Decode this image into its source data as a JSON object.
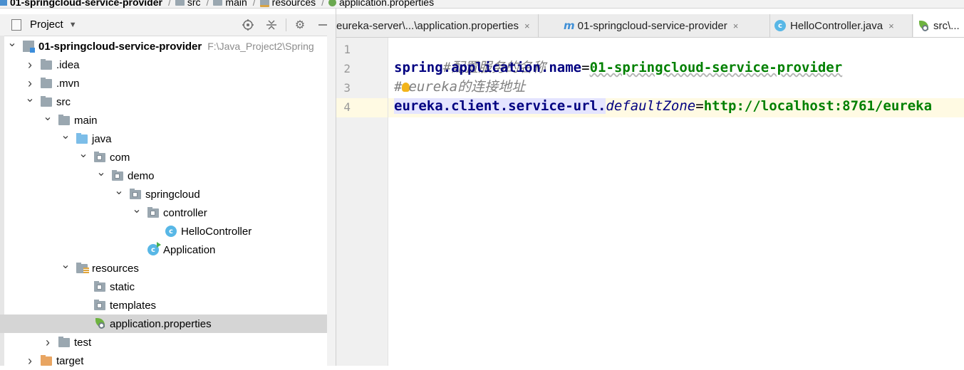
{
  "breadcrumb": {
    "project": "01-springcloud-service-provider",
    "items": [
      "src",
      "main",
      "resources",
      "application.properties"
    ]
  },
  "project_pane": {
    "title": "Project",
    "tree": [
      {
        "label": "01-springcloud-service-provider",
        "path": "F:\\Java_Project2\\Spring",
        "arrow": "down",
        "icon": "module-icon",
        "bold": true
      },
      {
        "label": ".idea",
        "arrow": "right",
        "icon": "folder-icon"
      },
      {
        "label": ".mvn",
        "arrow": "right",
        "icon": "folder-icon"
      },
      {
        "label": "src",
        "arrow": "down",
        "icon": "folder-icon"
      },
      {
        "label": "main",
        "arrow": "down",
        "icon": "folder-icon"
      },
      {
        "label": "java",
        "arrow": "down",
        "icon": "source-folder-icon"
      },
      {
        "label": "com",
        "arrow": "down",
        "icon": "package-icon"
      },
      {
        "label": "demo",
        "arrow": "down",
        "icon": "package-icon"
      },
      {
        "label": "springcloud",
        "arrow": "down",
        "icon": "package-icon"
      },
      {
        "label": "controller",
        "arrow": "down",
        "icon": "package-icon"
      },
      {
        "label": "HelloController",
        "arrow": "none",
        "icon": "class-icon"
      },
      {
        "label": "Application",
        "arrow": "none",
        "icon": "spring-boot-class-icon"
      },
      {
        "label": "resources",
        "arrow": "down",
        "icon": "resources-folder-icon"
      },
      {
        "label": "static",
        "arrow": "none",
        "icon": "package-icon"
      },
      {
        "label": "templates",
        "arrow": "none",
        "icon": "package-icon"
      },
      {
        "label": "application.properties",
        "arrow": "none",
        "icon": "spring-properties-icon",
        "selected": true
      },
      {
        "label": "test",
        "arrow": "right",
        "icon": "folder-icon"
      },
      {
        "label": "target",
        "arrow": "right",
        "icon": "excluded-folder-icon"
      }
    ]
  },
  "editor": {
    "tabs": [
      {
        "label": "eureka-server\\...\\application.properties",
        "close": "×"
      },
      {
        "label": "01-springcloud-service-provider",
        "prefix": "m",
        "close": "×"
      },
      {
        "label": "HelloController.java",
        "close": "×"
      },
      {
        "label": "src\\...",
        "active": true
      }
    ],
    "lines": [
      {
        "no": "1",
        "comment": "#配置服务的名称"
      },
      {
        "no": "2",
        "key": "spring.application.name",
        "eq": "=",
        "value": "01-springcloud-service-provider"
      },
      {
        "no": "3",
        "comment_hash": "#",
        "comment": "eureka的连接地址"
      },
      {
        "no": "4",
        "key": "eureka.client.service-url.",
        "key_italic": "defaultZone",
        "eq": "=",
        "value": "http://localhost:8761/eureka"
      }
    ],
    "class_badge": "c",
    "module_badge": "m"
  }
}
